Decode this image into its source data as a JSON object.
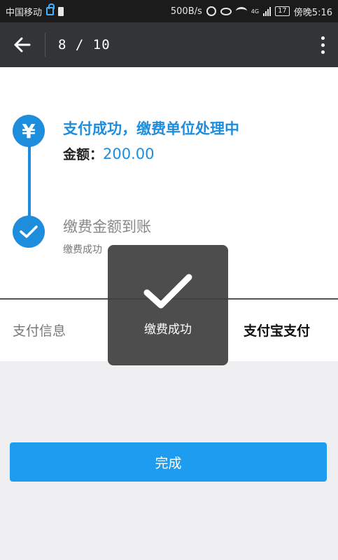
{
  "status_bar": {
    "carrier": "中国移动",
    "speed": "500B/s",
    "network": "4G",
    "battery": "17",
    "time": "傍晚5:16"
  },
  "app_bar": {
    "page_counter": "8 / 10"
  },
  "steps": [
    {
      "title": "支付成功，缴费单位处理中",
      "amount_label": "金额：",
      "amount_value": "200.00"
    },
    {
      "title": "缴费金额到账",
      "subtitle": "缴费成功"
    }
  ],
  "pay_info": {
    "label": "支付信息",
    "method": "支付宝支付"
  },
  "toast": {
    "text": "缴费成功"
  },
  "done_button": {
    "label": "完成"
  },
  "colors": {
    "accent": "#1e8ddc",
    "button": "#1e9df0",
    "app_bar": "#333436"
  }
}
